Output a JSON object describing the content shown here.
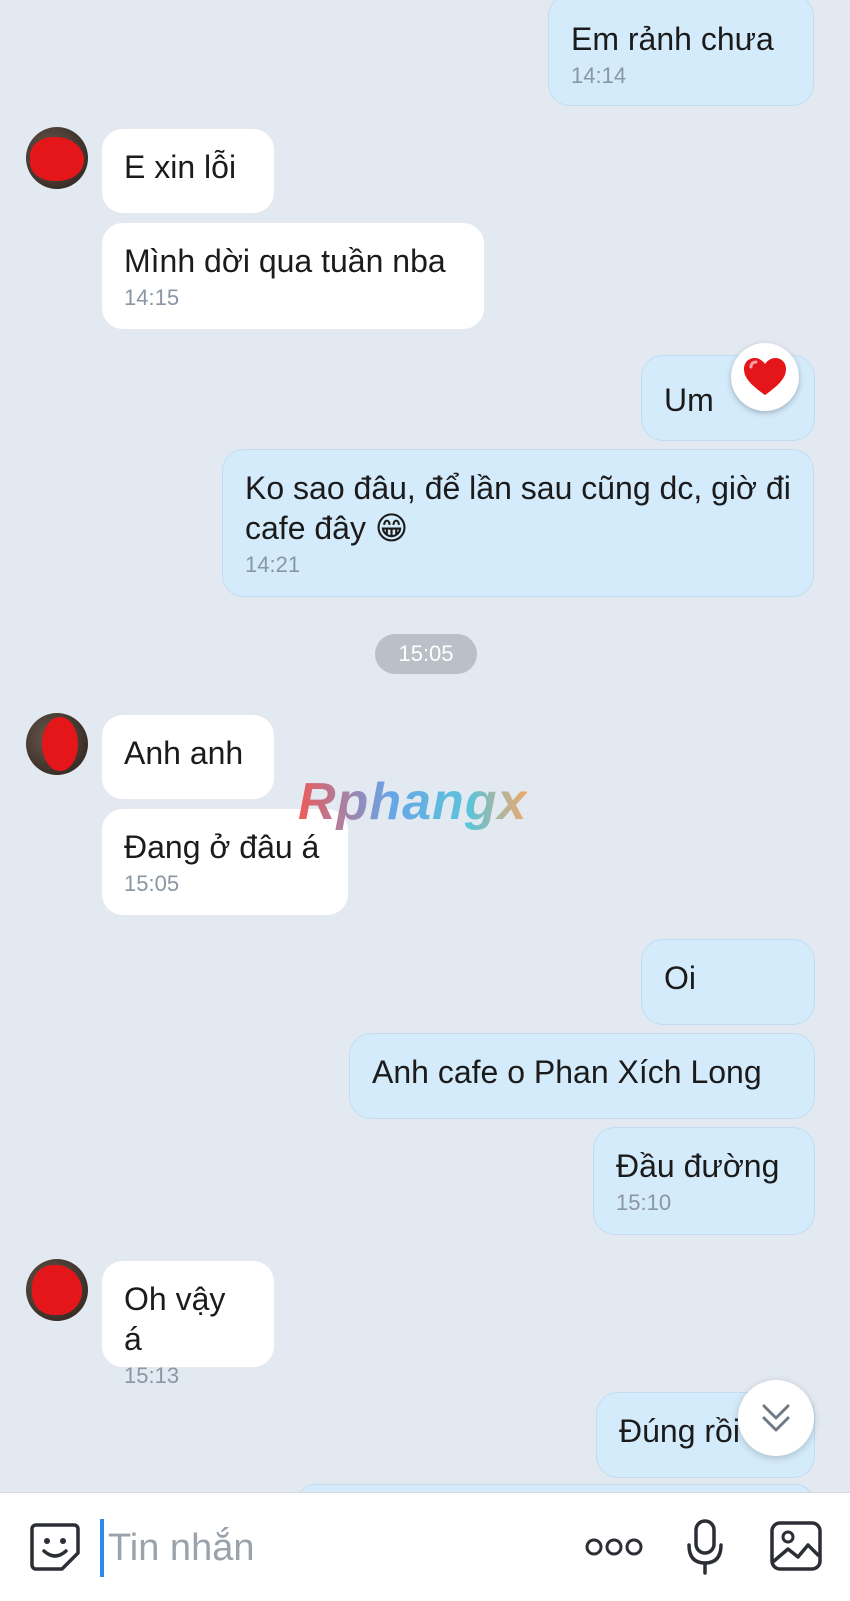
{
  "messages": [
    {
      "side": "out",
      "text": "Em rảnh chưa",
      "time": "14:14"
    },
    {
      "side": "in",
      "text": "E xin lỗi",
      "time": ""
    },
    {
      "side": "in",
      "text": "Mình dời qua tuần nba",
      "time": "14:15"
    },
    {
      "side": "out",
      "text": "Um",
      "time": "",
      "reaction": "heart"
    },
    {
      "side": "out",
      "text": "Ko sao đâu, để lần sau cũng dc, giờ đi cafe đây 😁",
      "time": "14:21"
    },
    {
      "side": "in",
      "text": "Anh anh",
      "time": ""
    },
    {
      "side": "in",
      "text": "Đang ở đâu á",
      "time": "15:05"
    },
    {
      "side": "out",
      "text": "Oi",
      "time": ""
    },
    {
      "side": "out",
      "text": "Anh cafe o Phan Xích Long",
      "time": ""
    },
    {
      "side": "out",
      "text": "Đầu đường",
      "time": "15:10"
    },
    {
      "side": "in",
      "text": "Oh vậy á",
      "time": "15:13"
    },
    {
      "side": "out",
      "text": "Đúng rồi",
      "time": ""
    }
  ],
  "divider": {
    "time": "15:05"
  },
  "watermark": "Rphangx",
  "composer": {
    "placeholder": "Tin nhắn"
  },
  "icons": {
    "reaction": "heart-icon",
    "scroll": "chevron-double-down-icon",
    "emoji": "sticker-icon",
    "more": "more-icon",
    "mic": "microphone-icon",
    "image": "image-icon"
  },
  "colors": {
    "background": "#e2e9f1",
    "incoming_bubble": "#ffffff",
    "outgoing_bubble": "#d4ebfb",
    "time_text": "#8a96a3",
    "heart": "#e5161a",
    "cursor": "#2a8ce6"
  }
}
